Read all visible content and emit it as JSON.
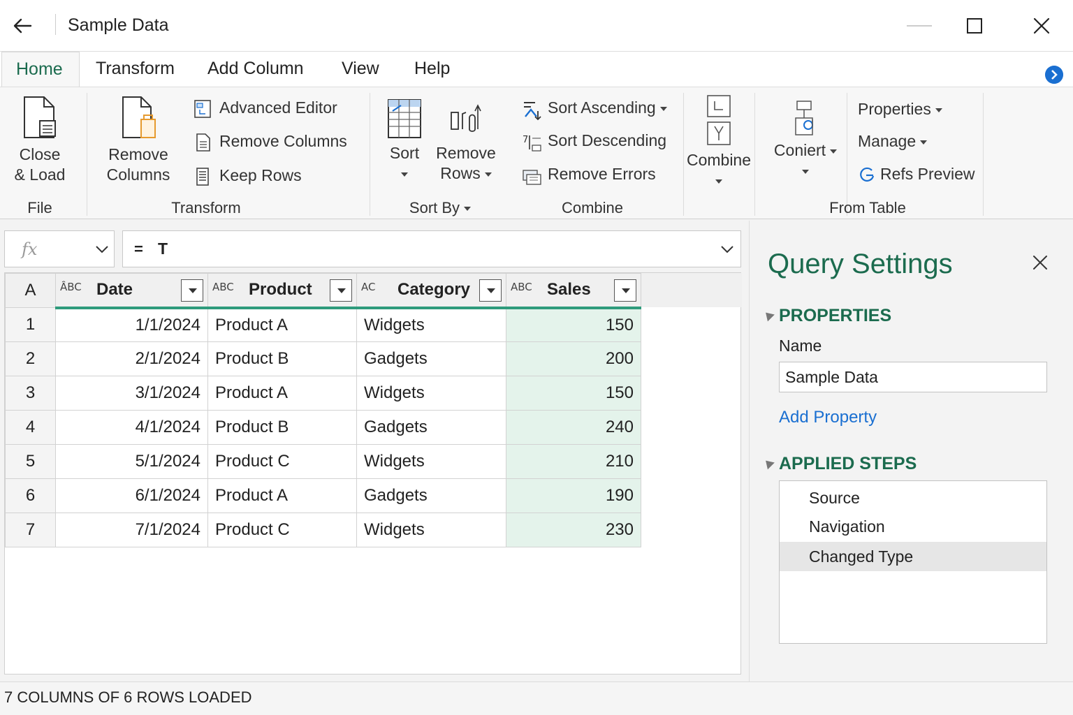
{
  "window": {
    "title": "Sample Data"
  },
  "tabs": [
    "Home",
    "Transform",
    "Add Column",
    "View",
    "Help"
  ],
  "ribbon": {
    "file": {
      "close_load_line1": "Close",
      "close_load_line2": "& Load",
      "group": "File"
    },
    "transform": {
      "remove_columns_line1": "Remove",
      "remove_columns_line2": "Columns",
      "advanced_editor": "Advanced Editor",
      "remove_columns": "Remove Columns",
      "keep_rows": "Keep Rows",
      "group": "Transform"
    },
    "sort": {
      "sort": "Sort",
      "remove_rows_line1": "Remove",
      "remove_rows_line2": "Rows",
      "group": "Sort By"
    },
    "combine": {
      "sort_ascending": "Sort Ascending",
      "sort_descending": "Sort Descending",
      "remove_errors": "Remove Errors",
      "group": "Combine",
      "combine_btn": "Combine"
    },
    "from_table": {
      "conier": "Conier‍t",
      "properties": "Properties",
      "manage": "Manage",
      "refs_preview": "Refs Preview",
      "group": "From Table"
    }
  },
  "formula_bar": {
    "fx": "fx",
    "equals": "=",
    "text": "T"
  },
  "grid": {
    "corner": "A",
    "columns": [
      {
        "name": "Date",
        "type_icon": "ȂBC"
      },
      {
        "name": "Product",
        "type_icon": "ABC"
      },
      {
        "name": "Category",
        "type_icon": "AC"
      },
      {
        "name": "Sales",
        "type_icon": "ABC"
      }
    ],
    "rows": [
      {
        "n": "1",
        "date": "1/1/2024",
        "product": "Product A",
        "category": "Widgets",
        "sales": "150"
      },
      {
        "n": "2",
        "date": "2/1/2024",
        "product": "Product B",
        "category": "Gadgets",
        "sales": "200"
      },
      {
        "n": "3",
        "date": "3/1/2024",
        "product": "Product A",
        "category": "Widgets",
        "sales": "150"
      },
      {
        "n": "4",
        "date": "4/1/2024",
        "product": "Product B",
        "category": "Gadgets",
        "sales": "240"
      },
      {
        "n": "5",
        "date": "5/1/2024",
        "product": "Product C",
        "category": "Widgets",
        "sales": "210"
      },
      {
        "n": "6",
        "date": "6/1/2024",
        "product": "Product A",
        "category": "Gadgets",
        "sales": "190"
      },
      {
        "n": "7",
        "date": "7/1/2024",
        "product": "Product C",
        "category": "Widgets",
        "sales": "230"
      }
    ]
  },
  "query_settings": {
    "title": "Query Settings",
    "properties_header": "PROPERTIES",
    "name_label": "Name",
    "name_value": "Sample Data",
    "add_property": "Add Property",
    "applied_steps_header": "APPLIED STEPS",
    "steps": [
      "Source",
      "Navigation",
      "Changed Type"
    ],
    "selected_step": 2
  },
  "status": {
    "text": "7 COLUMNS OF 6 ROWS LOADED"
  },
  "colors": {
    "accent_green": "#1b6b4e",
    "link_blue": "#1a6fd1",
    "sales_fill": "#e4f3eb"
  }
}
